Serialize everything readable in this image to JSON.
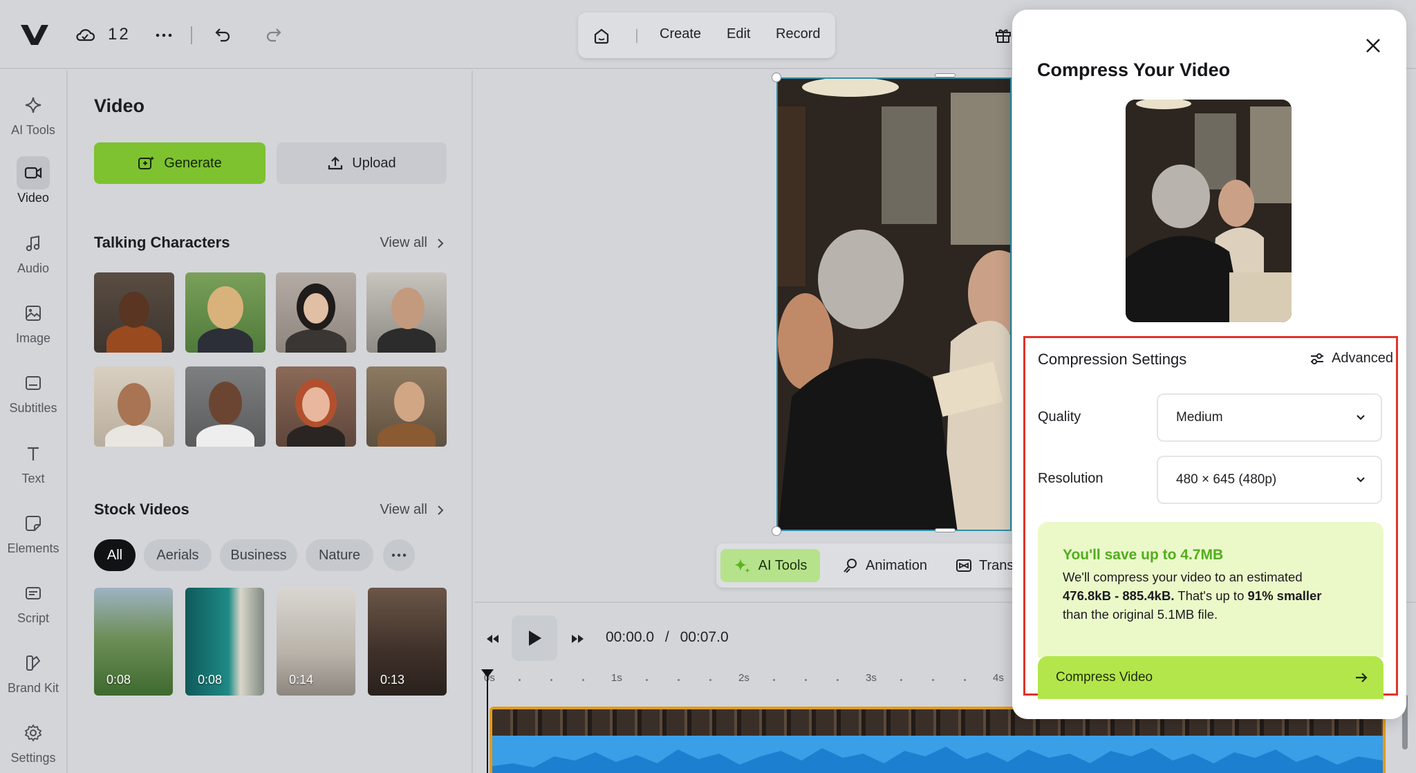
{
  "topbar": {
    "project_number": "12",
    "modes": [
      "Create",
      "Edit",
      "Record"
    ]
  },
  "rail": {
    "items": [
      {
        "label": "AI Tools",
        "icon": "sparkle-icon"
      },
      {
        "label": "Video",
        "icon": "video-camera-icon",
        "active": true
      },
      {
        "label": "Audio",
        "icon": "music-note-icon"
      },
      {
        "label": "Image",
        "icon": "image-icon"
      },
      {
        "label": "Subtitles",
        "icon": "subtitles-icon"
      },
      {
        "label": "Text",
        "icon": "text-t-icon"
      },
      {
        "label": "Elements",
        "icon": "sticker-icon"
      },
      {
        "label": "Script",
        "icon": "script-icon"
      },
      {
        "label": "Brand Kit",
        "icon": "brand-kit-icon"
      },
      {
        "label": "Settings",
        "icon": "gear-icon"
      }
    ]
  },
  "panel": {
    "title": "Video",
    "generate_label": "Generate",
    "upload_label": "Upload",
    "talking_title": "Talking Characters",
    "view_all": "View all",
    "stock_title": "Stock Videos",
    "chips": [
      "All",
      "Aerials",
      "Business",
      "Nature"
    ],
    "stock_durations": [
      "0:08",
      "0:08",
      "0:14",
      "0:13"
    ]
  },
  "toolstrip": {
    "ai_tools": "AI Tools",
    "animation": "Animation",
    "transitions": "Trans"
  },
  "playback": {
    "current": "00:00.0",
    "separator": "/",
    "total": "00:07.0",
    "ruler_labels": [
      "0s",
      "1s",
      "2s",
      "3s",
      "4s"
    ]
  },
  "modal": {
    "title": "Compress Your Video",
    "settings_title": "Compression Settings",
    "advanced_label": "Advanced",
    "quality_label": "Quality",
    "quality_value": "Medium",
    "resolution_label": "Resolution",
    "resolution_value": "480 × 645 (480p)",
    "savings_title": "You'll save up to 4.7MB",
    "savings_line1": "We'll compress your video to an estimated",
    "savings_range": "476.8kB - 885.4kB.",
    "savings_mid": " That's up to ",
    "savings_percent": "91% smaller",
    "savings_line3": "than the original 5.1MB file.",
    "compress_label": "Compress Video"
  },
  "colors": {
    "accent_green": "#7ec230",
    "highlight_red": "#e0332a",
    "savings_green": "#52ad1f",
    "track_orange": "#e29a1e"
  }
}
